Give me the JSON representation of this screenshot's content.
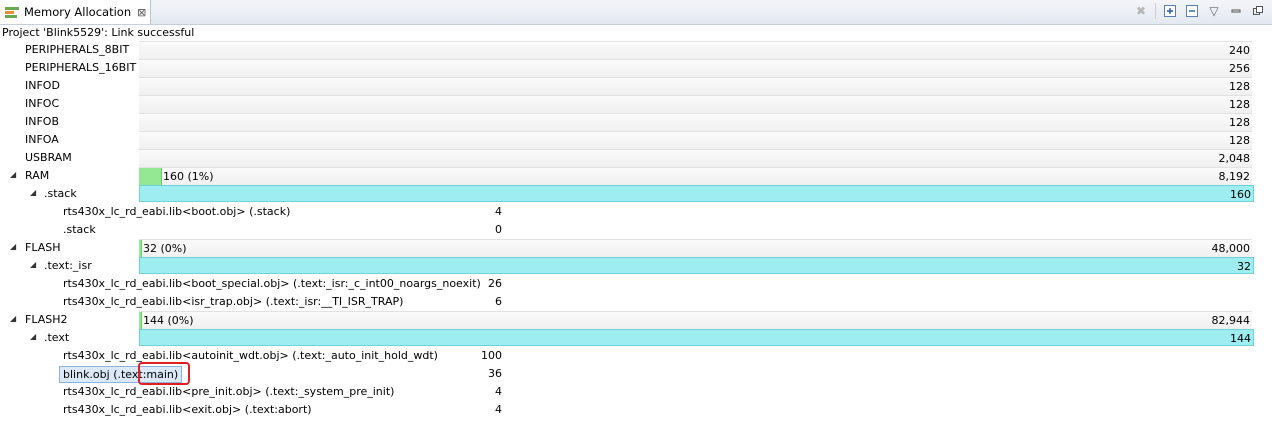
{
  "view": {
    "title": "Memory Allocation",
    "close_glyph": "⊠"
  },
  "status": "Project 'Blink5529': Link successful",
  "memory": [
    {
      "name": "PERIPHERALS_8BIT",
      "value": "240"
    },
    {
      "name": "PERIPHERALS_16BIT",
      "value": "256"
    },
    {
      "name": "INFOD",
      "value": "128"
    },
    {
      "name": "INFOC",
      "value": "128"
    },
    {
      "name": "INFOB",
      "value": "128"
    },
    {
      "name": "INFOA",
      "value": "128"
    },
    {
      "name": "USBRAM",
      "value": "2,048"
    },
    {
      "name": "RAM",
      "value": "8,192",
      "usage": "160 (1%)",
      "fill": 0.02
    },
    {
      "name": ".stack",
      "value": "160"
    },
    {
      "name": "rts430x_lc_rd_eabi.lib<boot.obj> (.stack)",
      "value": "4"
    },
    {
      "name": ".stack",
      "value": "0"
    },
    {
      "name": "FLASH",
      "value": "48,000",
      "usage": "32 (0%)",
      "fill": 0.0015
    },
    {
      "name": ".text:_isr",
      "value": "32"
    },
    {
      "name": "rts430x_lc_rd_eabi.lib<boot_special.obj> (.text:_isr:_c_int00_noargs_noexit)",
      "value": "26"
    },
    {
      "name": "rts430x_lc_rd_eabi.lib<isr_trap.obj> (.text:_isr:__TI_ISR_TRAP)",
      "value": "6"
    },
    {
      "name": "FLASH2",
      "value": "82,944",
      "usage": "144 (0%)",
      "fill": 0.0015
    },
    {
      "name": ".text",
      "value": "144"
    },
    {
      "name": "rts430x_lc_rd_eabi.lib<autoinit_wdt.obj> (.text:_auto_init_hold_wdt)",
      "value": "100"
    },
    {
      "name": "blink.obj (.text:main)",
      "value": "36"
    },
    {
      "name": "rts430x_lc_rd_eabi.lib<pre_init.obj> (.text:_system_pre_init)",
      "value": "4"
    },
    {
      "name": "rts430x_lc_rd_eabi.lib<exit.obj> (.text:abort)",
      "value": "4"
    }
  ],
  "glyphs": {
    "expanded": "◢",
    "close": "✕"
  }
}
